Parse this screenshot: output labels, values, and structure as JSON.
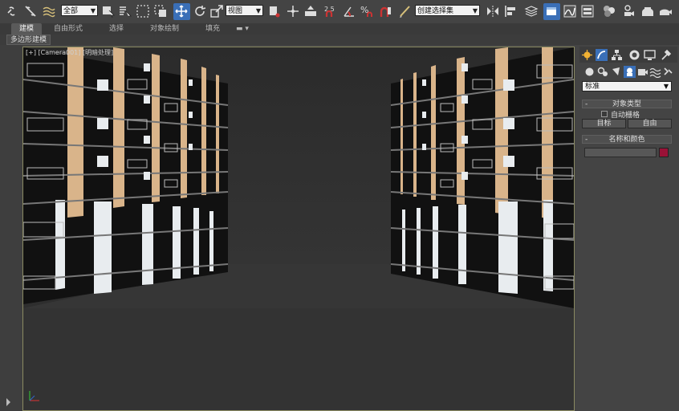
{
  "toolbar": {
    "filter_select": "全部",
    "refcoord_select": "视图",
    "selection_set_select": "创建选择集",
    "snap_angle_label": "2.5",
    "percent_label": "%",
    "icons": [
      "link-icon",
      "unlink-icon",
      "bind-spacewarp-icon",
      "select-object-icon",
      "select-by-name-icon",
      "rect-selection-icon",
      "window-crossing-icon",
      "move-icon",
      "rotate-icon",
      "scale-icon",
      "pivot-icon",
      "manipulate-icon",
      "keyboard-shortcut-icon",
      "snap-toggle-icon",
      "angle-snap-icon",
      "percent-snap-icon",
      "spinner-snap-icon",
      "edit-named-sets-icon",
      "mirror-icon",
      "align-icon",
      "layer-manager-icon",
      "graphite-toggle-icon",
      "curve-editor-icon",
      "schematic-view-icon",
      "material-editor-icon",
      "render-setup-icon",
      "rendered-frame-icon",
      "render-icon"
    ]
  },
  "ribbon": {
    "tabs": [
      "建模",
      "自由形式",
      "选择",
      "对象绘制",
      "填充"
    ],
    "active_tab": "建模",
    "sub_tab": "多边形建模"
  },
  "viewport": {
    "label": "[+] [Camera001] [明暗处理]"
  },
  "command_panel": {
    "tab_icons": [
      "create-icon",
      "modify-icon",
      "hierarchy-icon",
      "motion-icon",
      "display-icon",
      "utilities-icon"
    ],
    "category_icons": [
      "geometry-icon",
      "shapes-icon",
      "lights-icon",
      "cameras-icon",
      "helpers-icon",
      "spacewarps-icon",
      "systems-icon"
    ],
    "dropdown_value": "标准",
    "object_type": {
      "title": "对象类型",
      "autogrid_label": "自动栅格",
      "buttons": [
        "目标",
        "自由"
      ]
    },
    "name_color": {
      "title": "名称和颜色",
      "name_value": "",
      "color": "#9a1237"
    }
  },
  "colors": {
    "accent": "#3a6fb7",
    "viewport_bg": "#2e2e2e",
    "facade_warm": "#d9b48a",
    "facade_white": "#e8ecef"
  }
}
